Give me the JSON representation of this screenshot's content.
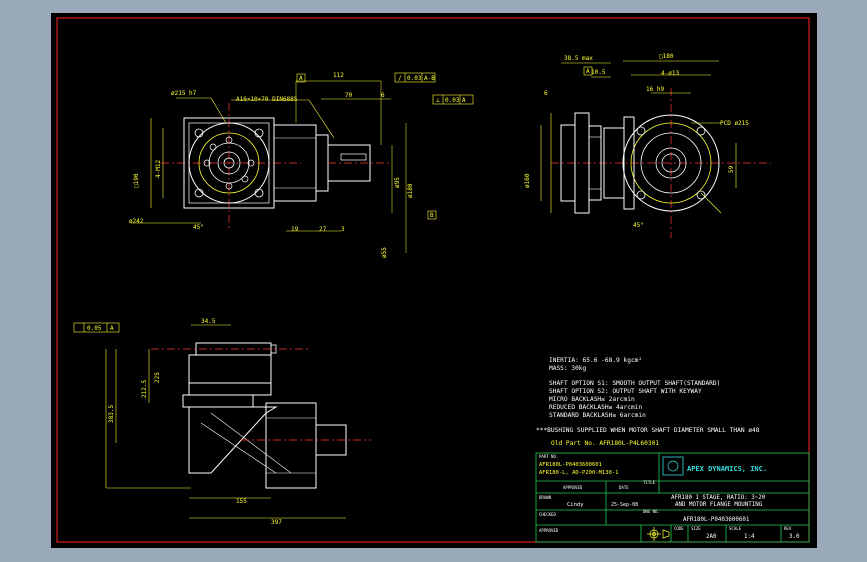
{
  "dimensions": {
    "d215h7": "ø215 h7",
    "a16x10x70": "A16×10×70 DIN6885",
    "d112": "112",
    "d70": "70",
    "d6": "6",
    "flatness": {
      "sym": "/",
      "tol": "0.03",
      "datum": "A-B"
    },
    "runout": {
      "sym": "⊥",
      "tol": "0.03",
      "datum": "A"
    },
    "d191": "□190",
    "dmax": "4-M12",
    "d242": "ø242",
    "ang45": "45°",
    "d19": "19",
    "d27": "27",
    "d3": "3",
    "d95": "ø95",
    "d180": "ø180",
    "d55": "ø55",
    "d48": "48",
    "b": "B",
    "a": "A",
    "a_side": "A",
    "d385": "38.5 max",
    "d105": "10.5",
    "d180b": "□180",
    "d413": "4-ø13",
    "d16": "16 h9",
    "d6b": "6",
    "pcd": "PCD ø215",
    "d59": "59",
    "d160": "ø160",
    "d45b": "45°",
    "perp": {
      "tol": "0.05",
      "datum": "A"
    },
    "d345": "34.5",
    "d225": "225",
    "d3835": "383.5",
    "d155": "155",
    "d397": "397",
    "d2125": "212.5"
  },
  "notes": {
    "inertia": "INERTIA:    65.6 -68.9 kgcm²",
    "mass": "MASS: 30kg",
    "shaft_s1": "SHAFT OPTION S1: SMOOTH OUTPUT SHAFT(STANDARD)",
    "shaft_s2": "SHAFT OPTION S2: OUTPUT SHAFT WITH KEYWAY",
    "micro": "MICRO BACKLASH≤ 2arcmin",
    "reduced": "REDUCED BACKLASH≤ 4arcmin",
    "standard": "STANDARD BACKLASH≤ 6arcmin",
    "bushing": "***BUSHING SUPPLIED WHEN MOTOR SHAFT DIAMETER SMALL THAN ø48",
    "old_part": "Old Part No. AFR180L-P4L60301"
  },
  "title_block": {
    "part_no_label": "PART NO.",
    "part_no_1": "AFR180L-P0403600601",
    "part_no_2": "AFR180-L, AD-P200-M130-1",
    "company": "APEX DYNAMICS, INC.",
    "approved_label": "APPROVED",
    "date_label": "DATE",
    "title_label": "TITLE",
    "title_1": "AFR180 1 STAGE, RATIO: 3~20",
    "title_2": "AND MOTOR FLANGE MOUNTING",
    "drawn_label": "DRAWN",
    "drawn_by": "Cindy",
    "drawn_date": "25-Sep-08",
    "dwg_label": "DWG NO.",
    "dwg_no": "AFR180L-P0403600601",
    "checked_label": "CHECKED",
    "size_label": "SIZE",
    "size": "A4",
    "scale_label": "SCALE",
    "scale": "1:4",
    "rev_label": "REV",
    "rev": "3.0",
    "code_label": "CODE",
    "code": "2A0",
    "approved2_label": "APPROVED"
  }
}
